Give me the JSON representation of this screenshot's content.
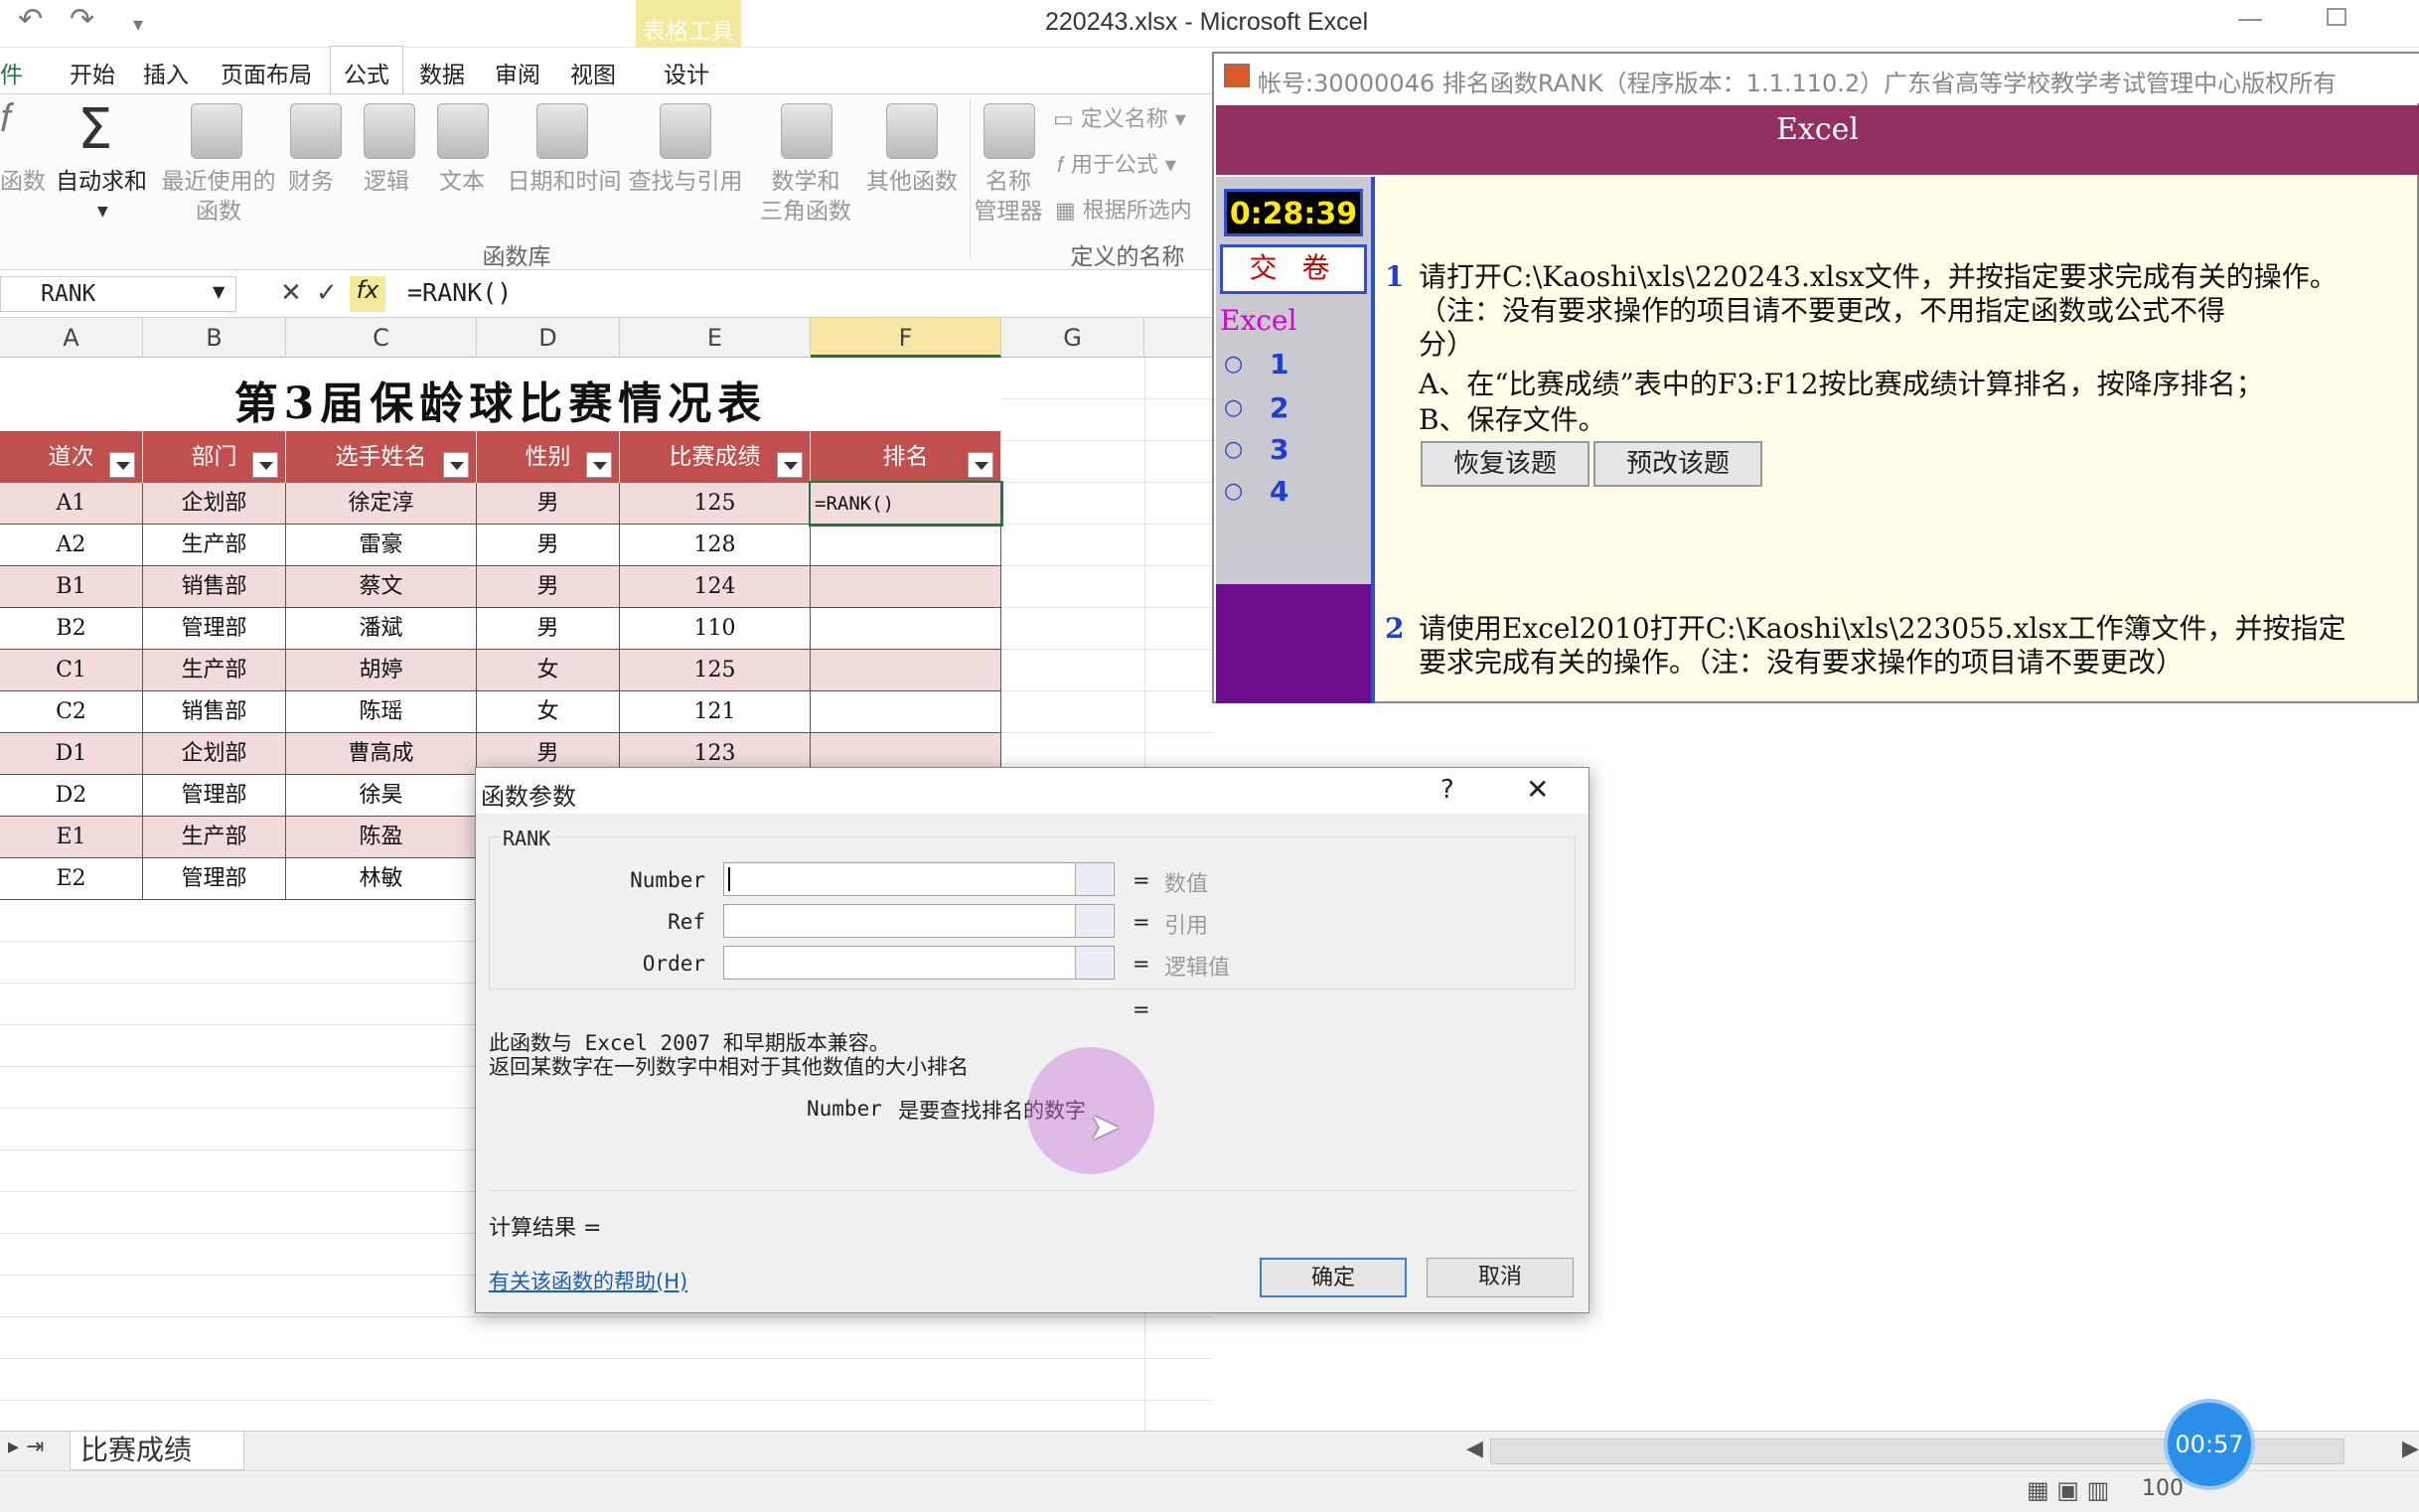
{
  "window": {
    "title": "220243.xlsx - Microsoft Excel",
    "context_tab_group": "表格工具"
  },
  "ribbon": {
    "tabs": [
      "件",
      "开始",
      "插入",
      "页面布局",
      "公式",
      "数据",
      "审阅",
      "视图",
      "设计"
    ],
    "active_tab": "公式",
    "buttons": [
      "函数",
      "自动求和",
      "最近使用的",
      "函数",
      "财务",
      "逻辑",
      "文本",
      "日期和时间",
      "查找与引用",
      "数学和",
      "三角函数",
      "其他函数",
      "名称",
      "管理器"
    ],
    "small_buttons": [
      "定义名称",
      "用于公式",
      "根据所选内"
    ],
    "groups": [
      "函数库",
      "定义的名称"
    ]
  },
  "formula_bar": {
    "name_box": "RANK",
    "formula": "=RANK()"
  },
  "columns": [
    "A",
    "B",
    "C",
    "D",
    "E",
    "F",
    "G"
  ],
  "sheet": {
    "title": "第3届保龄球比赛情况表",
    "headers": [
      "道次",
      "部门",
      "选手姓名",
      "性别",
      "比赛成绩",
      "排名"
    ],
    "rows": [
      [
        "A1",
        "企划部",
        "徐定淳",
        "男",
        "125",
        "=RANK()"
      ],
      [
        "A2",
        "生产部",
        "雷豪",
        "男",
        "128",
        ""
      ],
      [
        "B1",
        "销售部",
        "蔡文",
        "男",
        "124",
        ""
      ],
      [
        "B2",
        "管理部",
        "潘斌",
        "男",
        "110",
        ""
      ],
      [
        "C1",
        "生产部",
        "胡婷",
        "女",
        "125",
        ""
      ],
      [
        "C2",
        "销售部",
        "陈瑶",
        "女",
        "121",
        ""
      ],
      [
        "D1",
        "企划部",
        "曹高成",
        "男",
        "123",
        ""
      ],
      [
        "D2",
        "管理部",
        "徐昊",
        "",
        "",
        ""
      ],
      [
        "E1",
        "生产部",
        "陈盈",
        "",
        "",
        ""
      ],
      [
        "E2",
        "管理部",
        "林敏",
        "",
        "",
        ""
      ]
    ],
    "tab_name": "比赛成绩"
  },
  "dialog": {
    "title": "函数参数",
    "help_glyph": "?",
    "close_glyph": "✕",
    "function_name": "RANK",
    "args": [
      {
        "label": "Number",
        "hint": "数值"
      },
      {
        "label": "Ref",
        "hint": "引用"
      },
      {
        "label": "Order",
        "hint": "逻辑值"
      }
    ],
    "eq": "=",
    "desc1": "此函数与 Excel 2007 和早期版本兼容。",
    "desc2": "返回某数字在一列数字中相对于其他数值的大小排名",
    "arg_desc_name": "Number",
    "arg_desc": "是要查找排名的数字",
    "result_label": "计算结果 =",
    "help_link": "有关该函数的帮助(H)",
    "ok": "确定",
    "cancel": "取消"
  },
  "exam_panel": {
    "title": "帐号:30000046  排名函数RANK（程序版本：1.1.110.2）广东省高等学校教学考试管理中心版权所有",
    "header": "Excel",
    "timer": "0:28:39",
    "submit": "交 卷",
    "side_label": "Excel",
    "side_items": [
      "1",
      "2",
      "3",
      "4"
    ],
    "q1_num": "1",
    "q1_lines": [
      "请打开C:\\Kaoshi\\xls\\220243.xlsx文件，并按指定要求完成有关的操作。",
      "（注：没有要求操作的项目请不要更改，不用指定函数或公式不得",
      "分）",
      "A、在“比赛成绩”表中的F3:F12按比赛成绩计算排名，按降序排名；",
      "B、保存文件。"
    ],
    "restore_btn": "恢复该题",
    "preview_btn": "预改该题",
    "q2_num": "2",
    "q2_lines": [
      "请使用Excel2010打开C:\\Kaoshi\\xls\\223055.xlsx工作簿文件，并按指定",
      "要求完成有关的操作。（注：没有要求操作的项目请不要更改）"
    ]
  },
  "status": {
    "zoom": "100",
    "recorder_time": "00:57"
  }
}
